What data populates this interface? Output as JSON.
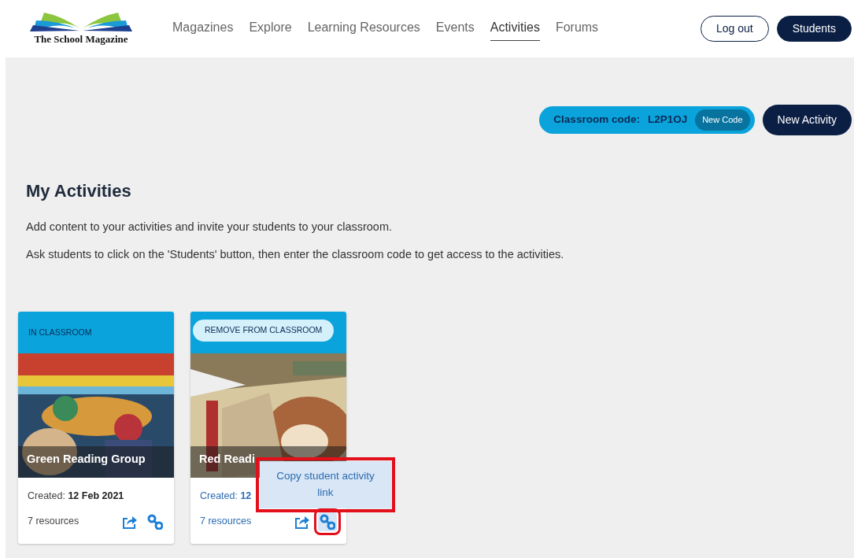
{
  "header": {
    "logo_text": "The School Magazine",
    "nav": [
      {
        "label": "Magazines",
        "selected": false
      },
      {
        "label": "Explore",
        "selected": false
      },
      {
        "label": "Learning Resources",
        "selected": false
      },
      {
        "label": "Events",
        "selected": false
      },
      {
        "label": "Activities",
        "selected": true
      },
      {
        "label": "Forums",
        "selected": false
      }
    ],
    "buttons": [
      {
        "label": "Log out",
        "kind": "outline"
      },
      {
        "label": "Students",
        "kind": "solid"
      }
    ]
  },
  "classroom": {
    "label": "Classroom code:",
    "code": "L2P1OJ",
    "new_code": "New Code"
  },
  "new_activity": "New Activity",
  "heading": "My Activities",
  "paragraphs": [
    "Add content to your activities and invite your students to your classroom.",
    "Ask students to click on the 'Students' button, then enter the classroom code to get access to the activities."
  ],
  "cards": [
    {
      "status": {
        "label": "IN CLASSROOM",
        "kind": "label"
      },
      "title": "Green Reading Group",
      "created_label": "Created:",
      "created_date": "12 Feb 2021",
      "resources": "7 resources",
      "hovered": false,
      "link_active": false
    },
    {
      "status": {
        "label": "REMOVE FROM CLASSROOM",
        "kind": "button"
      },
      "title": "Red Readi",
      "created_label": "Created:",
      "created_date": "12",
      "resources": "7 resources",
      "hovered": true,
      "link_active": true
    }
  ],
  "tooltip": {
    "text": "Copy student activity link",
    "outlined": true
  }
}
